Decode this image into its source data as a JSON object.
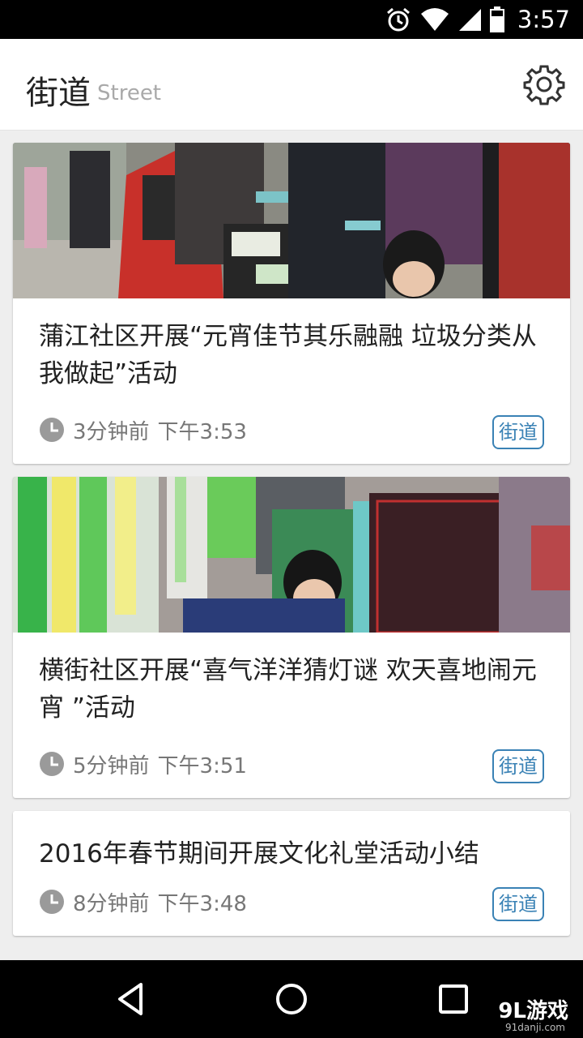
{
  "status_bar": {
    "time": "3:57"
  },
  "header": {
    "title": "街道",
    "subtitle": "Street"
  },
  "cards": [
    {
      "title": "蒲江社区开展“元宵佳节其乐融融 垃圾分类从我做起”活动",
      "relative_time": "3分钟前",
      "time": "下午3:53",
      "tag": "街道",
      "has_image": true
    },
    {
      "title": "横街社区开展“喜气洋洋猜灯谜 欢天喜地闹元宵 ”活动",
      "relative_time": "5分钟前",
      "time": "下午3:51",
      "tag": "街道",
      "has_image": true
    },
    {
      "title": "2016年春节期间开展文化礼堂活动小结",
      "relative_time": "8分钟前",
      "time": "下午3:48",
      "tag": "街道",
      "has_image": false
    }
  ],
  "watermark": {
    "text": "9L游戏",
    "sub": "91danji.com"
  },
  "colors": {
    "tag_accent": "#3a82b5",
    "status_bar": "#000000",
    "background": "#eeeeee"
  },
  "icons": [
    "alarm-icon",
    "wifi-icon",
    "cell-signal-icon",
    "battery-icon",
    "settings-gear-icon",
    "clock-icon",
    "back-icon",
    "home-icon",
    "recents-icon"
  ]
}
